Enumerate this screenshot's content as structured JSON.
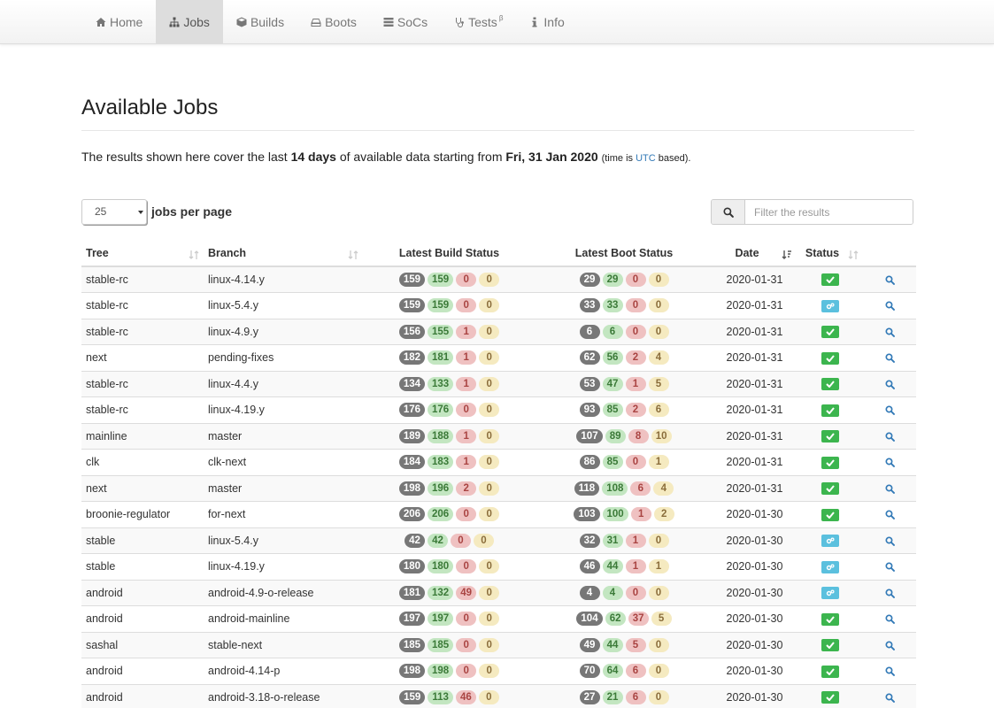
{
  "nav": [
    {
      "label": "Home",
      "icon": "home-icon",
      "active": false
    },
    {
      "label": "Jobs",
      "icon": "sitemap-icon",
      "active": true
    },
    {
      "label": "Builds",
      "icon": "cube-icon",
      "active": false
    },
    {
      "label": "Boots",
      "icon": "hdd-icon",
      "active": false
    },
    {
      "label": "SoCs",
      "icon": "server-icon",
      "active": false
    },
    {
      "label": "Tests",
      "icon": "stethoscope-icon",
      "active": false,
      "badge": "β"
    },
    {
      "label": "Info",
      "icon": "info-icon",
      "active": false
    }
  ],
  "page": {
    "title": "Available Jobs",
    "info_prefix": "The results shown here cover the last ",
    "info_days": "14 days",
    "info_mid": " of available data starting from ",
    "info_date": "Fri, 31 Jan 2020",
    "info_small_prefix": "(time is ",
    "info_utc": "UTC",
    "info_small_suffix": " based)."
  },
  "controls": {
    "per_page_value": "25",
    "per_page_label": "jobs per page",
    "search_placeholder": "Filter the results"
  },
  "table": {
    "headers": {
      "tree": "Tree",
      "branch": "Branch",
      "build_status": "Latest Build Status",
      "boot_status": "Latest Boot Status",
      "date": "Date",
      "status": "Status"
    },
    "rows": [
      {
        "tree": "stable-rc",
        "branch": "linux-4.14.y",
        "build": [
          "159",
          "159",
          "0",
          "0"
        ],
        "boot": [
          "29",
          "29",
          "0",
          "0"
        ],
        "date": "2020-01-31",
        "status": "pass"
      },
      {
        "tree": "stable-rc",
        "branch": "linux-5.4.y",
        "build": [
          "159",
          "159",
          "0",
          "0"
        ],
        "boot": [
          "33",
          "33",
          "0",
          "0"
        ],
        "date": "2020-01-31",
        "status": "build"
      },
      {
        "tree": "stable-rc",
        "branch": "linux-4.9.y",
        "build": [
          "156",
          "155",
          "1",
          "0"
        ],
        "boot": [
          "6",
          "6",
          "0",
          "0"
        ],
        "date": "2020-01-31",
        "status": "pass"
      },
      {
        "tree": "next",
        "branch": "pending-fixes",
        "build": [
          "182",
          "181",
          "1",
          "0"
        ],
        "boot": [
          "62",
          "56",
          "2",
          "4"
        ],
        "date": "2020-01-31",
        "status": "pass"
      },
      {
        "tree": "stable-rc",
        "branch": "linux-4.4.y",
        "build": [
          "134",
          "133",
          "1",
          "0"
        ],
        "boot": [
          "53",
          "47",
          "1",
          "5"
        ],
        "date": "2020-01-31",
        "status": "pass"
      },
      {
        "tree": "stable-rc",
        "branch": "linux-4.19.y",
        "build": [
          "176",
          "176",
          "0",
          "0"
        ],
        "boot": [
          "93",
          "85",
          "2",
          "6"
        ],
        "date": "2020-01-31",
        "status": "pass"
      },
      {
        "tree": "mainline",
        "branch": "master",
        "build": [
          "189",
          "188",
          "1",
          "0"
        ],
        "boot": [
          "107",
          "89",
          "8",
          "10"
        ],
        "date": "2020-01-31",
        "status": "pass"
      },
      {
        "tree": "clk",
        "branch": "clk-next",
        "build": [
          "184",
          "183",
          "1",
          "0"
        ],
        "boot": [
          "86",
          "85",
          "0",
          "1"
        ],
        "date": "2020-01-31",
        "status": "pass"
      },
      {
        "tree": "next",
        "branch": "master",
        "build": [
          "198",
          "196",
          "2",
          "0"
        ],
        "boot": [
          "118",
          "108",
          "6",
          "4"
        ],
        "date": "2020-01-31",
        "status": "pass"
      },
      {
        "tree": "broonie-regulator",
        "branch": "for-next",
        "build": [
          "206",
          "206",
          "0",
          "0"
        ],
        "boot": [
          "103",
          "100",
          "1",
          "2"
        ],
        "date": "2020-01-30",
        "status": "pass"
      },
      {
        "tree": "stable",
        "branch": "linux-5.4.y",
        "build": [
          "42",
          "42",
          "0",
          "0"
        ],
        "boot": [
          "32",
          "31",
          "1",
          "0"
        ],
        "date": "2020-01-30",
        "status": "build"
      },
      {
        "tree": "stable",
        "branch": "linux-4.19.y",
        "build": [
          "180",
          "180",
          "0",
          "0"
        ],
        "boot": [
          "46",
          "44",
          "1",
          "1"
        ],
        "date": "2020-01-30",
        "status": "build"
      },
      {
        "tree": "android",
        "branch": "android-4.9-o-release",
        "build": [
          "181",
          "132",
          "49",
          "0"
        ],
        "boot": [
          "4",
          "4",
          "0",
          "0"
        ],
        "date": "2020-01-30",
        "status": "build"
      },
      {
        "tree": "android",
        "branch": "android-mainline",
        "build": [
          "197",
          "197",
          "0",
          "0"
        ],
        "boot": [
          "104",
          "62",
          "37",
          "5"
        ],
        "date": "2020-01-30",
        "status": "pass"
      },
      {
        "tree": "sashal",
        "branch": "stable-next",
        "build": [
          "185",
          "185",
          "0",
          "0"
        ],
        "boot": [
          "49",
          "44",
          "5",
          "0"
        ],
        "date": "2020-01-30",
        "status": "pass"
      },
      {
        "tree": "android",
        "branch": "android-4.14-p",
        "build": [
          "198",
          "198",
          "0",
          "0"
        ],
        "boot": [
          "70",
          "64",
          "6",
          "0"
        ],
        "date": "2020-01-30",
        "status": "pass"
      },
      {
        "tree": "android",
        "branch": "android-3.18-o-release",
        "build": [
          "159",
          "113",
          "46",
          "0"
        ],
        "boot": [
          "27",
          "21",
          "6",
          "0"
        ],
        "date": "2020-01-30",
        "status": "pass"
      }
    ]
  }
}
